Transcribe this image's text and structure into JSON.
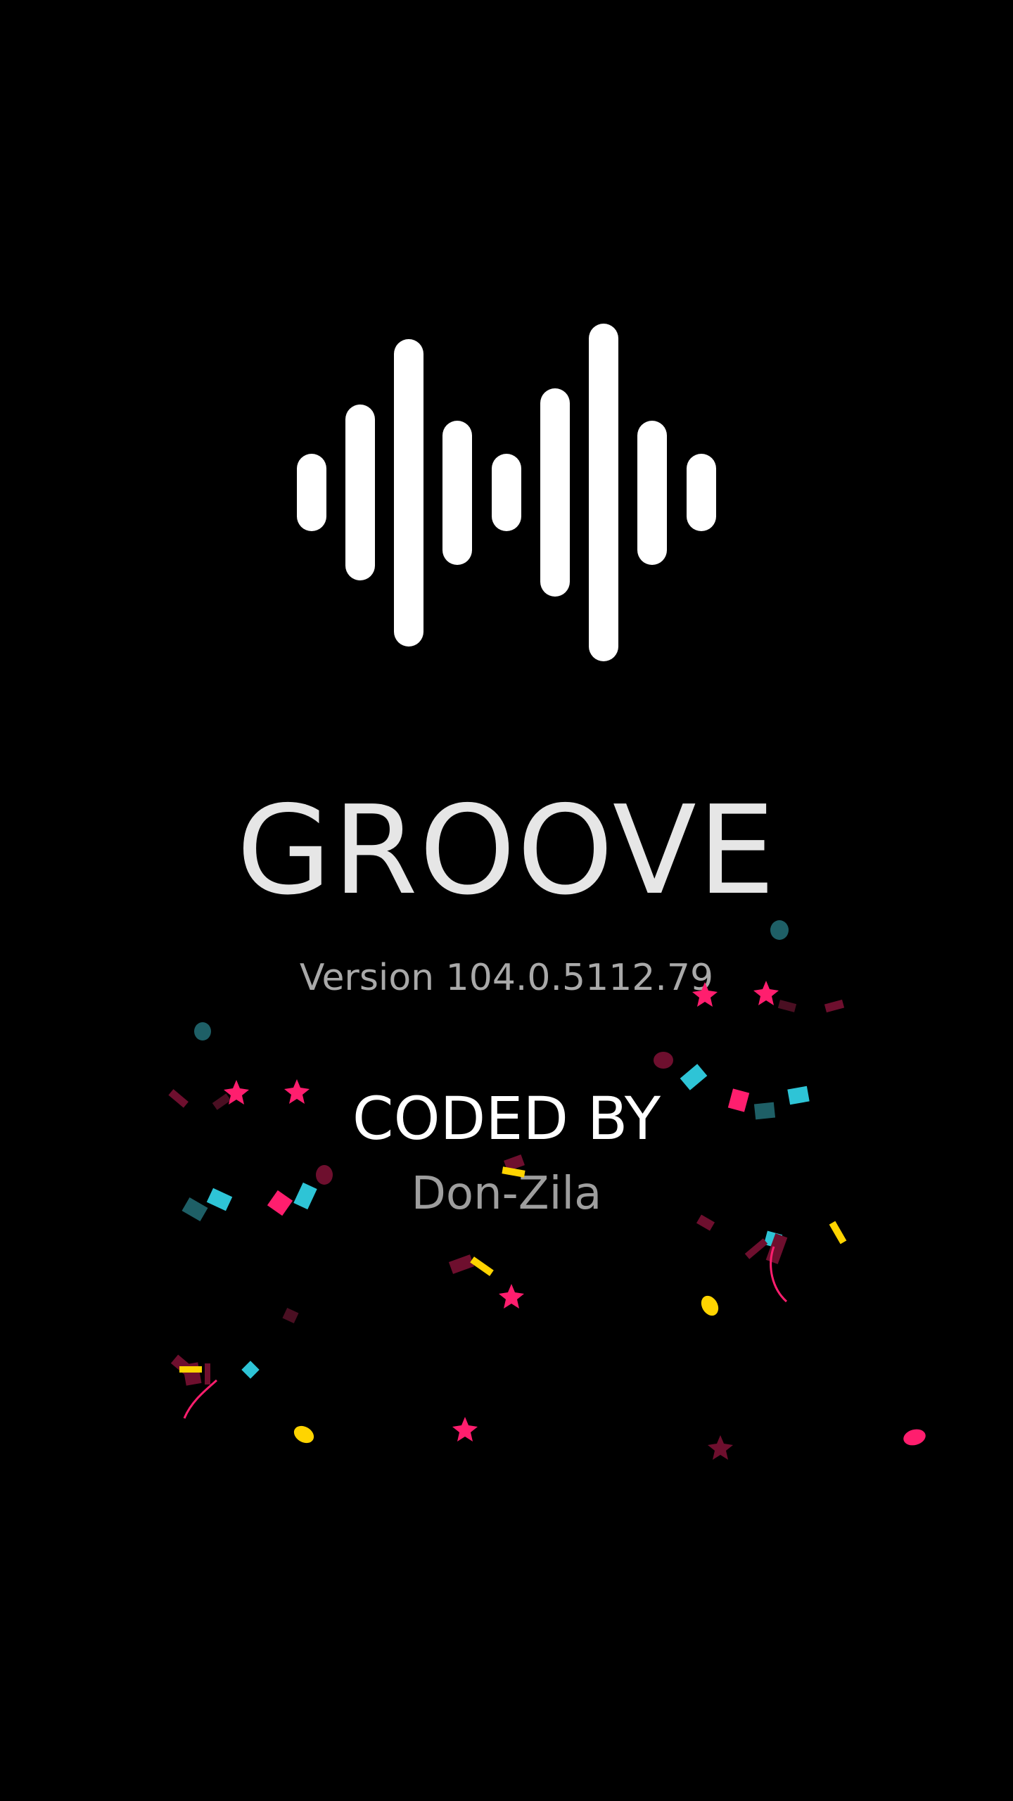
{
  "app": {
    "title": "GROOVE",
    "version": "Version 104.0.5112.79"
  },
  "credits": {
    "label": "CODED BY",
    "author": "Don-Zila"
  },
  "logo": {
    "icon": "sound-wave-icon",
    "color": "#FFFFFF"
  },
  "colors": {
    "background": "#000000",
    "title": "#E6E6E6",
    "secondary_text": "#A9A9A9",
    "confetti_pink": "#FF1E6E",
    "confetti_cyan": "#2EC4D6",
    "confetti_teal": "#1E5F66",
    "confetti_yellow": "#FFD400",
    "confetti_maroon": "#6E0F2E"
  }
}
